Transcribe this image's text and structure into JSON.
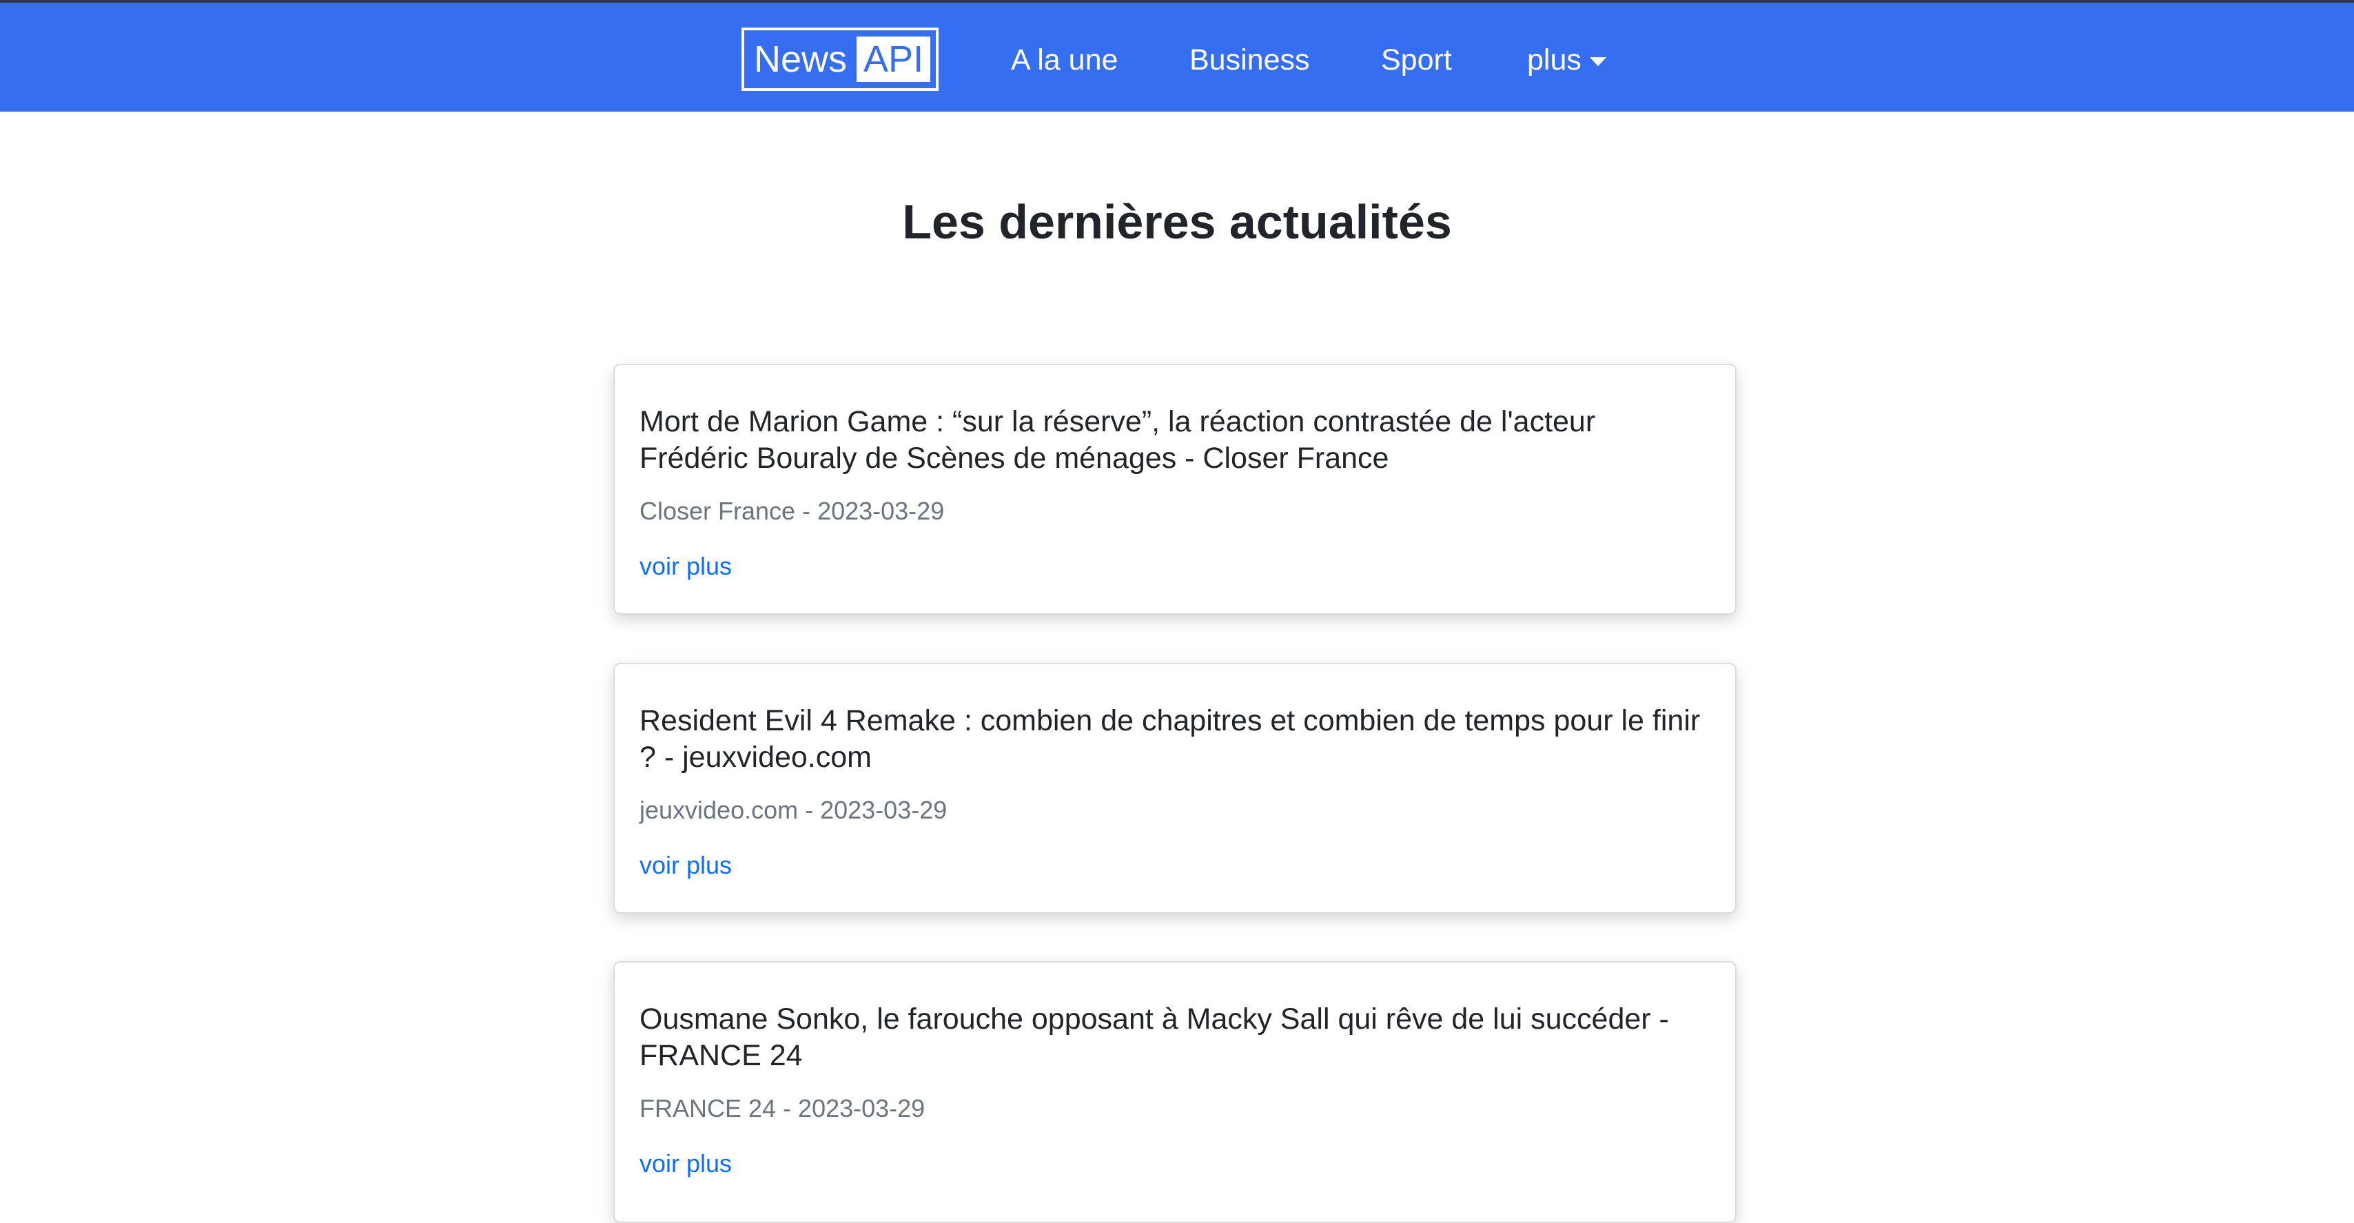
{
  "nav": {
    "brand_news": "News",
    "brand_api": "API",
    "links": [
      {
        "label": "A la une"
      },
      {
        "label": "Business"
      },
      {
        "label": "Sport"
      },
      {
        "label": "plus"
      }
    ],
    "colors": {
      "background": "#356ef1",
      "text": "#ffffff"
    }
  },
  "main": {
    "title": "Les dernières actualités",
    "articles": [
      {
        "title": "Mort de Marion Game : “sur la réserve”, la réaction contrastée de l'acteur Frédéric Bouraly de Scènes de ménages - Closer France",
        "meta": "Closer France - 2023-03-29",
        "link_label": "voir plus"
      },
      {
        "title": "Resident Evil 4 Remake : combien de chapitres et combien de temps pour le finir ? - jeuxvideo.com",
        "meta": "jeuxvideo.com - 2023-03-29",
        "link_label": "voir plus"
      },
      {
        "title": "Ousmane Sonko, le farouche opposant à Macky Sall qui rêve de lui succéder - FRANCE 24",
        "meta": "FRANCE 24 - 2023-03-29",
        "link_label": "voir plus"
      }
    ],
    "link_color": "#0d6efd",
    "meta_color": "#6c757d"
  }
}
